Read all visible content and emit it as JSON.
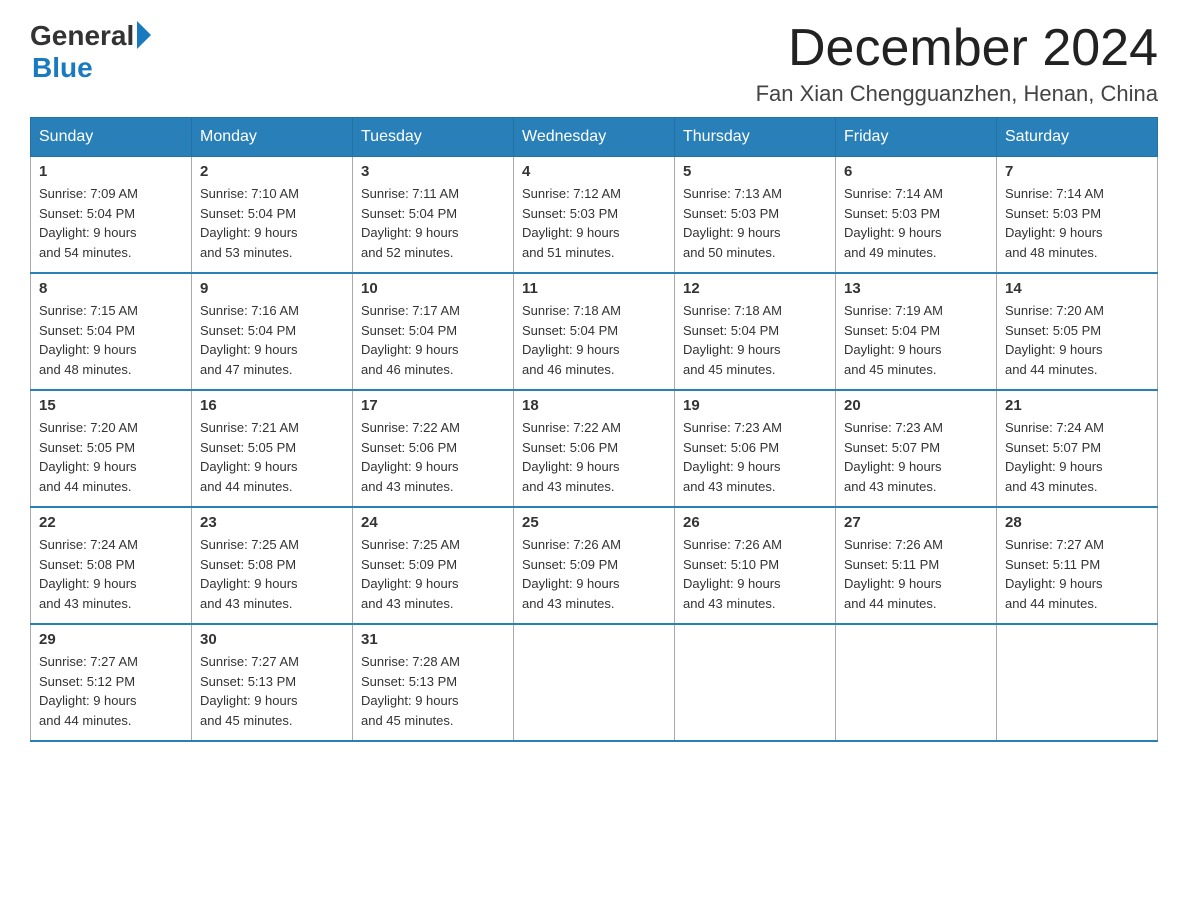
{
  "header": {
    "logo_general": "General",
    "logo_blue": "Blue",
    "main_title": "December 2024",
    "subtitle": "Fan Xian Chengguanzhen, Henan, China"
  },
  "weekdays": [
    "Sunday",
    "Monday",
    "Tuesday",
    "Wednesday",
    "Thursday",
    "Friday",
    "Saturday"
  ],
  "weeks": [
    [
      {
        "day": "1",
        "sunrise": "7:09 AM",
        "sunset": "5:04 PM",
        "daylight": "9 hours and 54 minutes."
      },
      {
        "day": "2",
        "sunrise": "7:10 AM",
        "sunset": "5:04 PM",
        "daylight": "9 hours and 53 minutes."
      },
      {
        "day": "3",
        "sunrise": "7:11 AM",
        "sunset": "5:04 PM",
        "daylight": "9 hours and 52 minutes."
      },
      {
        "day": "4",
        "sunrise": "7:12 AM",
        "sunset": "5:03 PM",
        "daylight": "9 hours and 51 minutes."
      },
      {
        "day": "5",
        "sunrise": "7:13 AM",
        "sunset": "5:03 PM",
        "daylight": "9 hours and 50 minutes."
      },
      {
        "day": "6",
        "sunrise": "7:14 AM",
        "sunset": "5:03 PM",
        "daylight": "9 hours and 49 minutes."
      },
      {
        "day": "7",
        "sunrise": "7:14 AM",
        "sunset": "5:03 PM",
        "daylight": "9 hours and 48 minutes."
      }
    ],
    [
      {
        "day": "8",
        "sunrise": "7:15 AM",
        "sunset": "5:04 PM",
        "daylight": "9 hours and 48 minutes."
      },
      {
        "day": "9",
        "sunrise": "7:16 AM",
        "sunset": "5:04 PM",
        "daylight": "9 hours and 47 minutes."
      },
      {
        "day": "10",
        "sunrise": "7:17 AM",
        "sunset": "5:04 PM",
        "daylight": "9 hours and 46 minutes."
      },
      {
        "day": "11",
        "sunrise": "7:18 AM",
        "sunset": "5:04 PM",
        "daylight": "9 hours and 46 minutes."
      },
      {
        "day": "12",
        "sunrise": "7:18 AM",
        "sunset": "5:04 PM",
        "daylight": "9 hours and 45 minutes."
      },
      {
        "day": "13",
        "sunrise": "7:19 AM",
        "sunset": "5:04 PM",
        "daylight": "9 hours and 45 minutes."
      },
      {
        "day": "14",
        "sunrise": "7:20 AM",
        "sunset": "5:05 PM",
        "daylight": "9 hours and 44 minutes."
      }
    ],
    [
      {
        "day": "15",
        "sunrise": "7:20 AM",
        "sunset": "5:05 PM",
        "daylight": "9 hours and 44 minutes."
      },
      {
        "day": "16",
        "sunrise": "7:21 AM",
        "sunset": "5:05 PM",
        "daylight": "9 hours and 44 minutes."
      },
      {
        "day": "17",
        "sunrise": "7:22 AM",
        "sunset": "5:06 PM",
        "daylight": "9 hours and 43 minutes."
      },
      {
        "day": "18",
        "sunrise": "7:22 AM",
        "sunset": "5:06 PM",
        "daylight": "9 hours and 43 minutes."
      },
      {
        "day": "19",
        "sunrise": "7:23 AM",
        "sunset": "5:06 PM",
        "daylight": "9 hours and 43 minutes."
      },
      {
        "day": "20",
        "sunrise": "7:23 AM",
        "sunset": "5:07 PM",
        "daylight": "9 hours and 43 minutes."
      },
      {
        "day": "21",
        "sunrise": "7:24 AM",
        "sunset": "5:07 PM",
        "daylight": "9 hours and 43 minutes."
      }
    ],
    [
      {
        "day": "22",
        "sunrise": "7:24 AM",
        "sunset": "5:08 PM",
        "daylight": "9 hours and 43 minutes."
      },
      {
        "day": "23",
        "sunrise": "7:25 AM",
        "sunset": "5:08 PM",
        "daylight": "9 hours and 43 minutes."
      },
      {
        "day": "24",
        "sunrise": "7:25 AM",
        "sunset": "5:09 PM",
        "daylight": "9 hours and 43 minutes."
      },
      {
        "day": "25",
        "sunrise": "7:26 AM",
        "sunset": "5:09 PM",
        "daylight": "9 hours and 43 minutes."
      },
      {
        "day": "26",
        "sunrise": "7:26 AM",
        "sunset": "5:10 PM",
        "daylight": "9 hours and 43 minutes."
      },
      {
        "day": "27",
        "sunrise": "7:26 AM",
        "sunset": "5:11 PM",
        "daylight": "9 hours and 44 minutes."
      },
      {
        "day": "28",
        "sunrise": "7:27 AM",
        "sunset": "5:11 PM",
        "daylight": "9 hours and 44 minutes."
      }
    ],
    [
      {
        "day": "29",
        "sunrise": "7:27 AM",
        "sunset": "5:12 PM",
        "daylight": "9 hours and 44 minutes."
      },
      {
        "day": "30",
        "sunrise": "7:27 AM",
        "sunset": "5:13 PM",
        "daylight": "9 hours and 45 minutes."
      },
      {
        "day": "31",
        "sunrise": "7:28 AM",
        "sunset": "5:13 PM",
        "daylight": "9 hours and 45 minutes."
      },
      null,
      null,
      null,
      null
    ]
  ]
}
